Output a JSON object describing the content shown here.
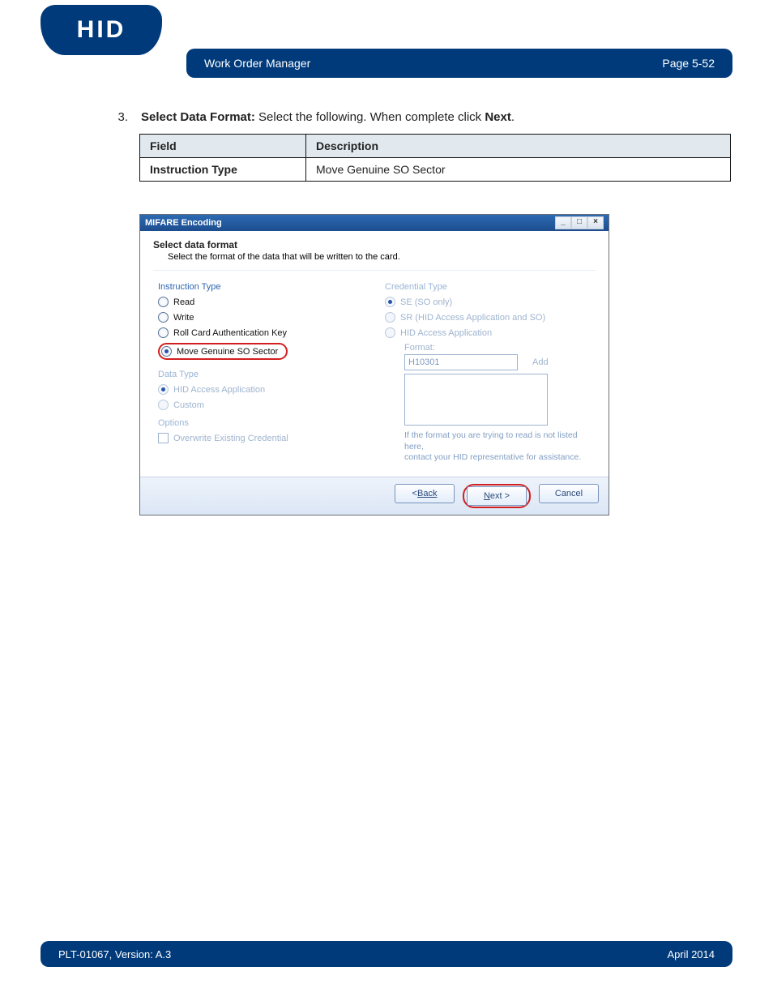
{
  "header": {
    "logo_text": "HID",
    "title": "Work Order Manager",
    "page_label": "Page 5-52"
  },
  "step": {
    "number": "3.",
    "bold": "Select Data Format:",
    "rest": " Select the following. When complete click ",
    "bold_end": "Next",
    "period": "."
  },
  "field_table": {
    "head_field": "Field",
    "head_desc": "Description",
    "row1_field": "Instruction Type",
    "row1_desc": "Move Genuine SO Sector"
  },
  "dialog": {
    "title": "MIFARE Encoding",
    "win_min": "_",
    "win_max": "□",
    "win_close": "×",
    "select_head": "Select data format",
    "select_sub": "Select the format of the data that will be written to the card.",
    "left": {
      "instruction_type": "Instruction Type",
      "read": "Read",
      "write": "Write",
      "roll": "Roll Card Authentication Key",
      "move": "Move Genuine SO Sector",
      "data_type": "Data Type",
      "hid_app": "HID Access Application",
      "custom": "Custom",
      "options": "Options",
      "overwrite": "Overwrite Existing Credential"
    },
    "right": {
      "cred_type": "Credential Type",
      "se": "SE (SO only)",
      "sr": "SR (HID Access Application and SO)",
      "hid_app": "HID Access Application",
      "format_label": "Format:",
      "format_value": "H10301",
      "add": "Add",
      "help1": "If the format you are trying to read is not listed here,",
      "help2": "contact your HID representative for assistance."
    },
    "buttons": {
      "back": "Back",
      "next": "Next >",
      "cancel": "Cancel"
    }
  },
  "footer": {
    "left": "PLT-01067, Version: A.3",
    "right": "April 2014"
  }
}
